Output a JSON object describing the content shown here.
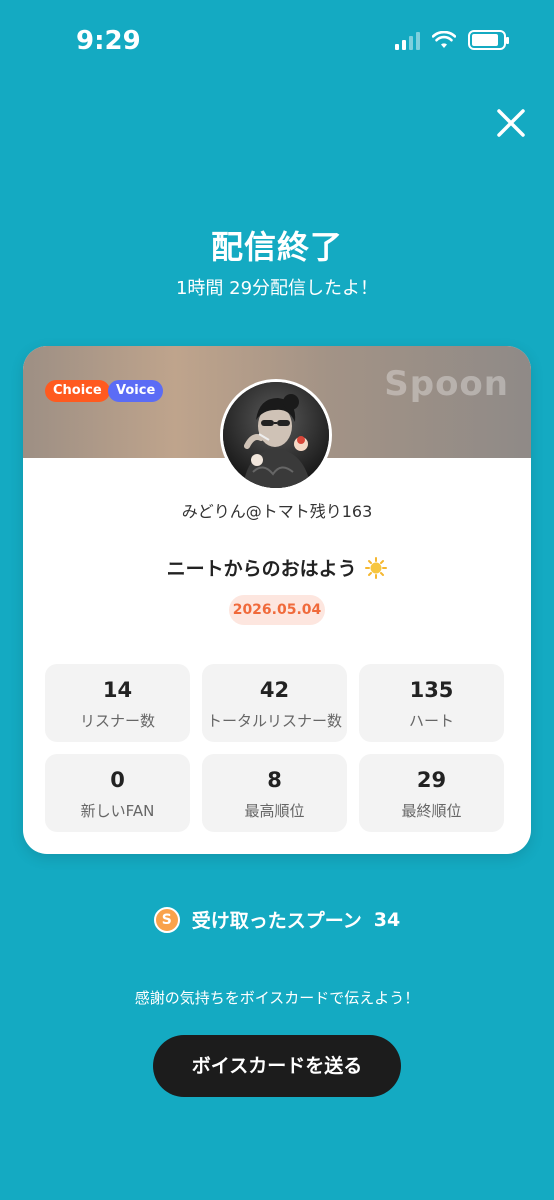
{
  "status_bar": {
    "time": "9:29",
    "battery_level": 0.85
  },
  "header": {
    "title": "配信終了",
    "subtitle": "1時間 29分配信したよ！"
  },
  "card": {
    "brand": "Spoon",
    "tags": [
      "Choice",
      "Voice"
    ],
    "username": "みどりん@トマト残り163",
    "live_title": "ニートからのおはよう",
    "date": "2026.05.04",
    "stats": [
      {
        "value": "14",
        "label": "リスナー数"
      },
      {
        "value": "42",
        "label": "トータルリスナー数"
      },
      {
        "value": "135",
        "label": "ハート"
      },
      {
        "value": "0",
        "label": "新しいFAN"
      },
      {
        "value": "8",
        "label": "最高順位"
      },
      {
        "value": "29",
        "label": "最終順位"
      }
    ]
  },
  "spoons": {
    "coin_symbol": "S",
    "label": "受け取ったスプーン",
    "count": "34"
  },
  "footer": {
    "message": "感謝の気持ちをボイスカードで伝えよう！",
    "button_label": "ボイスカードを送る"
  },
  "colors": {
    "background": "#14aac2",
    "choice_tag": "#ff5a1f",
    "voice_tag": "#5b6cf5",
    "date_text": "#f06a3b",
    "button": "#1c1c1c",
    "coin": "#f9a24b"
  }
}
